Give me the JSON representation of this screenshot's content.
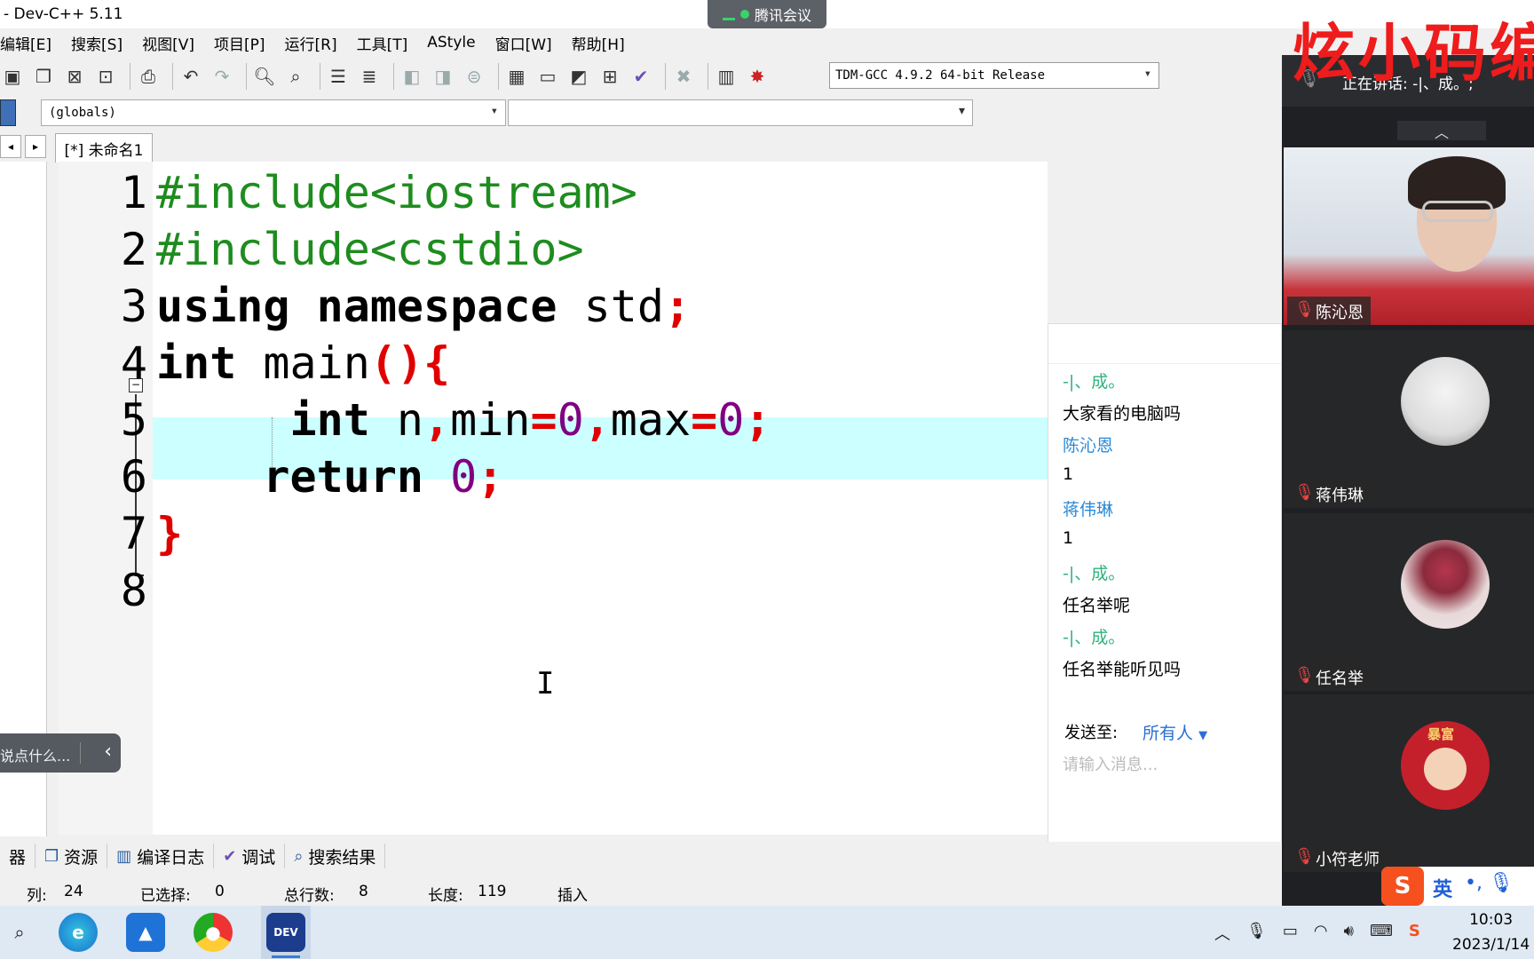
{
  "window": {
    "title": "- Dev-C++ 5.11"
  },
  "meeting_tag": {
    "label": "腾讯会议"
  },
  "menu": [
    "编辑[E]",
    "搜索[S]",
    "视图[V]",
    "项目[P]",
    "运行[R]",
    "工具[T]",
    "AStyle",
    "窗口[W]",
    "帮助[H]"
  ],
  "compiler": {
    "selected": "TDM-GCC 4.9.2 64-bit Release"
  },
  "scope": {
    "selected": "(globals)"
  },
  "file_tab": {
    "label": "[*] 未命名1"
  },
  "editor": {
    "line_numbers": [
      "1",
      "2",
      "3",
      "4",
      "5",
      "6",
      "7",
      "8"
    ],
    "lines": [
      {
        "segments": [
          {
            "text": "#include<iostream>",
            "class": "pp"
          }
        ]
      },
      {
        "segments": [
          {
            "text": "#include<cstdio>",
            "class": "pp"
          }
        ]
      },
      {
        "segments": [
          {
            "text": "using namespace ",
            "class": "kw"
          },
          {
            "text": "std",
            "class": ""
          },
          {
            "text": ";",
            "class": "pu"
          }
        ]
      },
      {
        "segments": [
          {
            "text": "int",
            "class": "kw"
          },
          {
            "text": " main",
            "class": ""
          },
          {
            "text": "(){",
            "class": "pu"
          }
        ]
      },
      {
        "segments": [
          {
            "text": "     int",
            "class": "kw"
          },
          {
            "text": " n",
            "class": ""
          },
          {
            "text": ",",
            "class": "pu"
          },
          {
            "text": "min",
            "class": ""
          },
          {
            "text": "=",
            "class": "pu"
          },
          {
            "text": "0",
            "class": "nm"
          },
          {
            "text": ",",
            "class": "pu"
          },
          {
            "text": "max",
            "class": ""
          },
          {
            "text": "=",
            "class": "pu"
          },
          {
            "text": "0",
            "class": "nm"
          },
          {
            "text": ";",
            "class": "pu"
          }
        ]
      },
      {
        "segments": [
          {
            "text": "    return",
            "class": "kw"
          },
          {
            "text": " ",
            "class": ""
          },
          {
            "text": "0",
            "class": "nm"
          },
          {
            "text": ";",
            "class": "pu"
          }
        ]
      },
      {
        "segments": [
          {
            "text": "}",
            "class": "pu"
          }
        ]
      },
      {
        "segments": []
      }
    ]
  },
  "danmaku": {
    "placeholder": "说点什么..."
  },
  "chat": {
    "messages": [
      {
        "text": "-|、成。",
        "kind": "name-green"
      },
      {
        "text": "大家看的电脑吗",
        "kind": "body"
      },
      {
        "text": "陈沁恩",
        "kind": "name-blue"
      },
      {
        "text": "1",
        "kind": "body"
      },
      {
        "text": "蒋伟琳",
        "kind": "name-blue"
      },
      {
        "text": "1",
        "kind": "body"
      },
      {
        "text": "-|、成。",
        "kind": "name-green"
      },
      {
        "text": "任名举呢",
        "kind": "body"
      },
      {
        "text": "-|、成。",
        "kind": "name-green"
      },
      {
        "text": "任名举能听见吗",
        "kind": "body"
      }
    ],
    "send_to_label": "发送至:",
    "send_to_value": "所有人",
    "input_placeholder": "请输入消息..."
  },
  "meeting": {
    "speaking": "正在讲话: -|、成。;",
    "participants": [
      "陈沁恩",
      "蒋伟琳",
      "任名举",
      "小符老师"
    ],
    "avatar_badge": "暴富"
  },
  "brand": {
    "text": "炫小码编"
  },
  "bottom_tabs": [
    "器",
    "资源",
    "编译日志",
    "调试",
    "搜索结果"
  ],
  "status": {
    "col_label": "列:",
    "col": "24",
    "sel_label": "已选择:",
    "sel": "0",
    "lines_label": "总行数:",
    "lines": "8",
    "len_label": "长度:",
    "len": "119",
    "mode": "插入"
  },
  "ime": {
    "lang": "英"
  },
  "clock": {
    "time": "10:03",
    "date": "2023/1/14"
  },
  "colors": {
    "accent": "#2a6fd6",
    "highlight_line": "#ccffff",
    "brand_red": "#ee1c1c"
  }
}
